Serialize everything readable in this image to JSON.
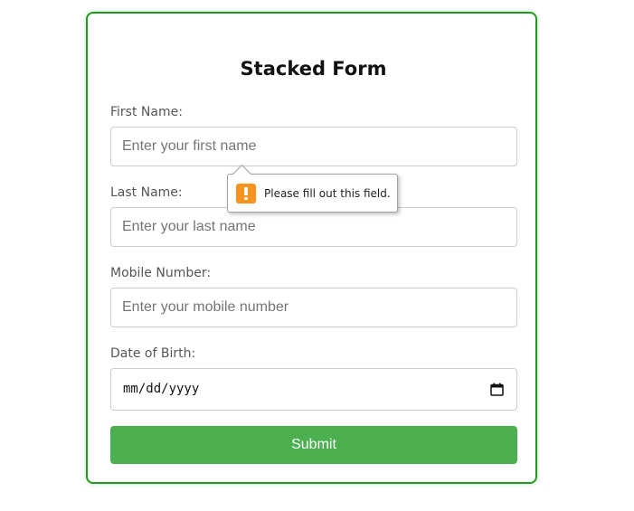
{
  "form": {
    "title": "Stacked Form",
    "fields": {
      "first_name": {
        "label": "First Name:",
        "placeholder": "Enter your first name",
        "value": ""
      },
      "last_name": {
        "label": "Last Name:",
        "placeholder": "Enter your last name",
        "value": ""
      },
      "mobile": {
        "label": "Mobile Number:",
        "placeholder": "Enter your mobile number",
        "value": ""
      },
      "dob": {
        "label": "Date of Birth:",
        "display": "mm/dd/yyyy"
      }
    },
    "submit_label": "Submit"
  },
  "validation_tooltip": {
    "message": "Please fill out this field.",
    "icon": "warning-icon"
  },
  "colors": {
    "card_border": "#1e9a1e",
    "submit_bg": "#4caf50",
    "warning": "#f7931e"
  }
}
